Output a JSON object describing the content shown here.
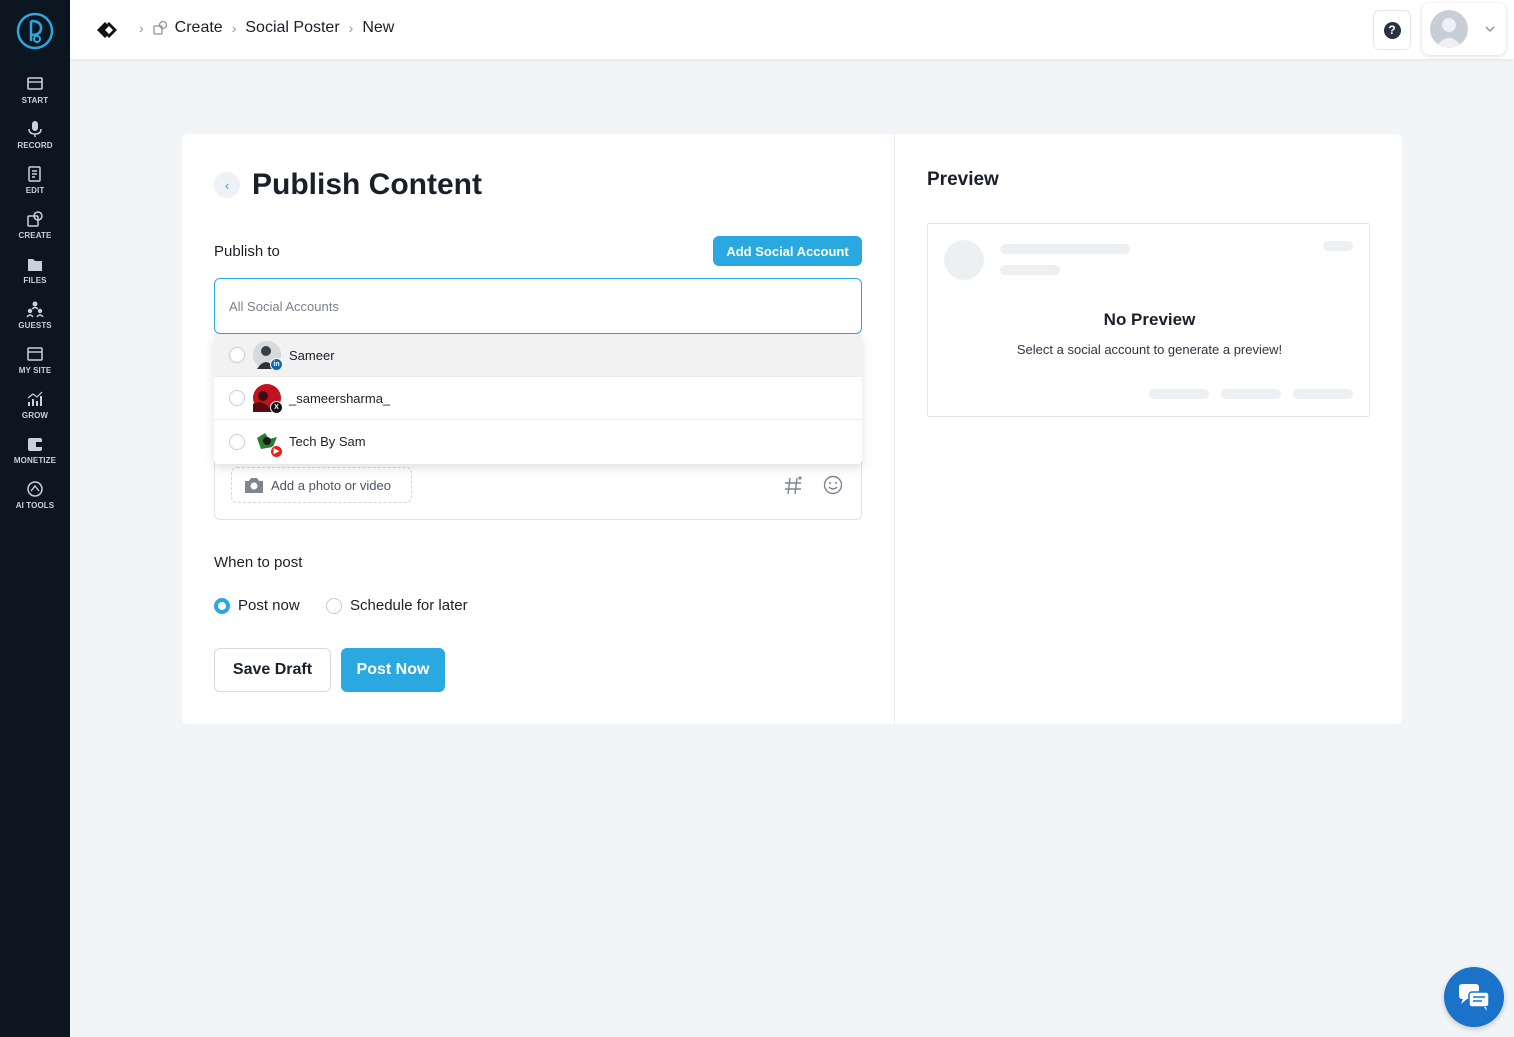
{
  "sidebar": {
    "items": [
      {
        "label": "START",
        "icon": "start-icon"
      },
      {
        "label": "RECORD",
        "icon": "microphone-icon"
      },
      {
        "label": "EDIT",
        "icon": "edit-icon"
      },
      {
        "label": "CREATE",
        "icon": "create-icon"
      },
      {
        "label": "FILES",
        "icon": "files-icon"
      },
      {
        "label": "GUESTS",
        "icon": "guests-icon"
      },
      {
        "label": "MY SITE",
        "icon": "my-site-icon"
      },
      {
        "label": "GROW",
        "icon": "grow-icon"
      },
      {
        "label": "MONETIZE",
        "icon": "monetize-icon"
      },
      {
        "label": "AI TOOLS",
        "icon": "ai-tools-icon"
      }
    ]
  },
  "header": {
    "breadcrumbs": [
      "Create",
      "Social Poster",
      "New"
    ],
    "help_label": "?"
  },
  "main": {
    "title": "Publish Content",
    "publish_to_label": "Publish to",
    "add_account_label": "Add Social Account",
    "accounts_placeholder": "All Social Accounts",
    "accounts": [
      {
        "name": "Sameer",
        "network": "linkedin",
        "badge": "in",
        "badge_color": "#0a66c2"
      },
      {
        "name": "_sameersharma_",
        "network": "x",
        "badge": "X",
        "badge_color": "#111111"
      },
      {
        "name": "Tech By Sam",
        "network": "youtube",
        "badge": "▶",
        "badge_color": "#e62117"
      }
    ],
    "media_label": "Add a photo or video",
    "when_label": "When to post",
    "post_now_option": "Post now",
    "schedule_option": "Schedule for later",
    "selected_option": "Post now",
    "save_draft_label": "Save Draft",
    "post_now_label": "Post Now"
  },
  "preview": {
    "title": "Preview",
    "empty_title": "No Preview",
    "empty_subtitle": "Select a social account to generate a preview!"
  },
  "colors": {
    "accent": "#2aa8e0",
    "sidebar_bg": "#0c1621",
    "chat_button": "#1a73c9"
  }
}
